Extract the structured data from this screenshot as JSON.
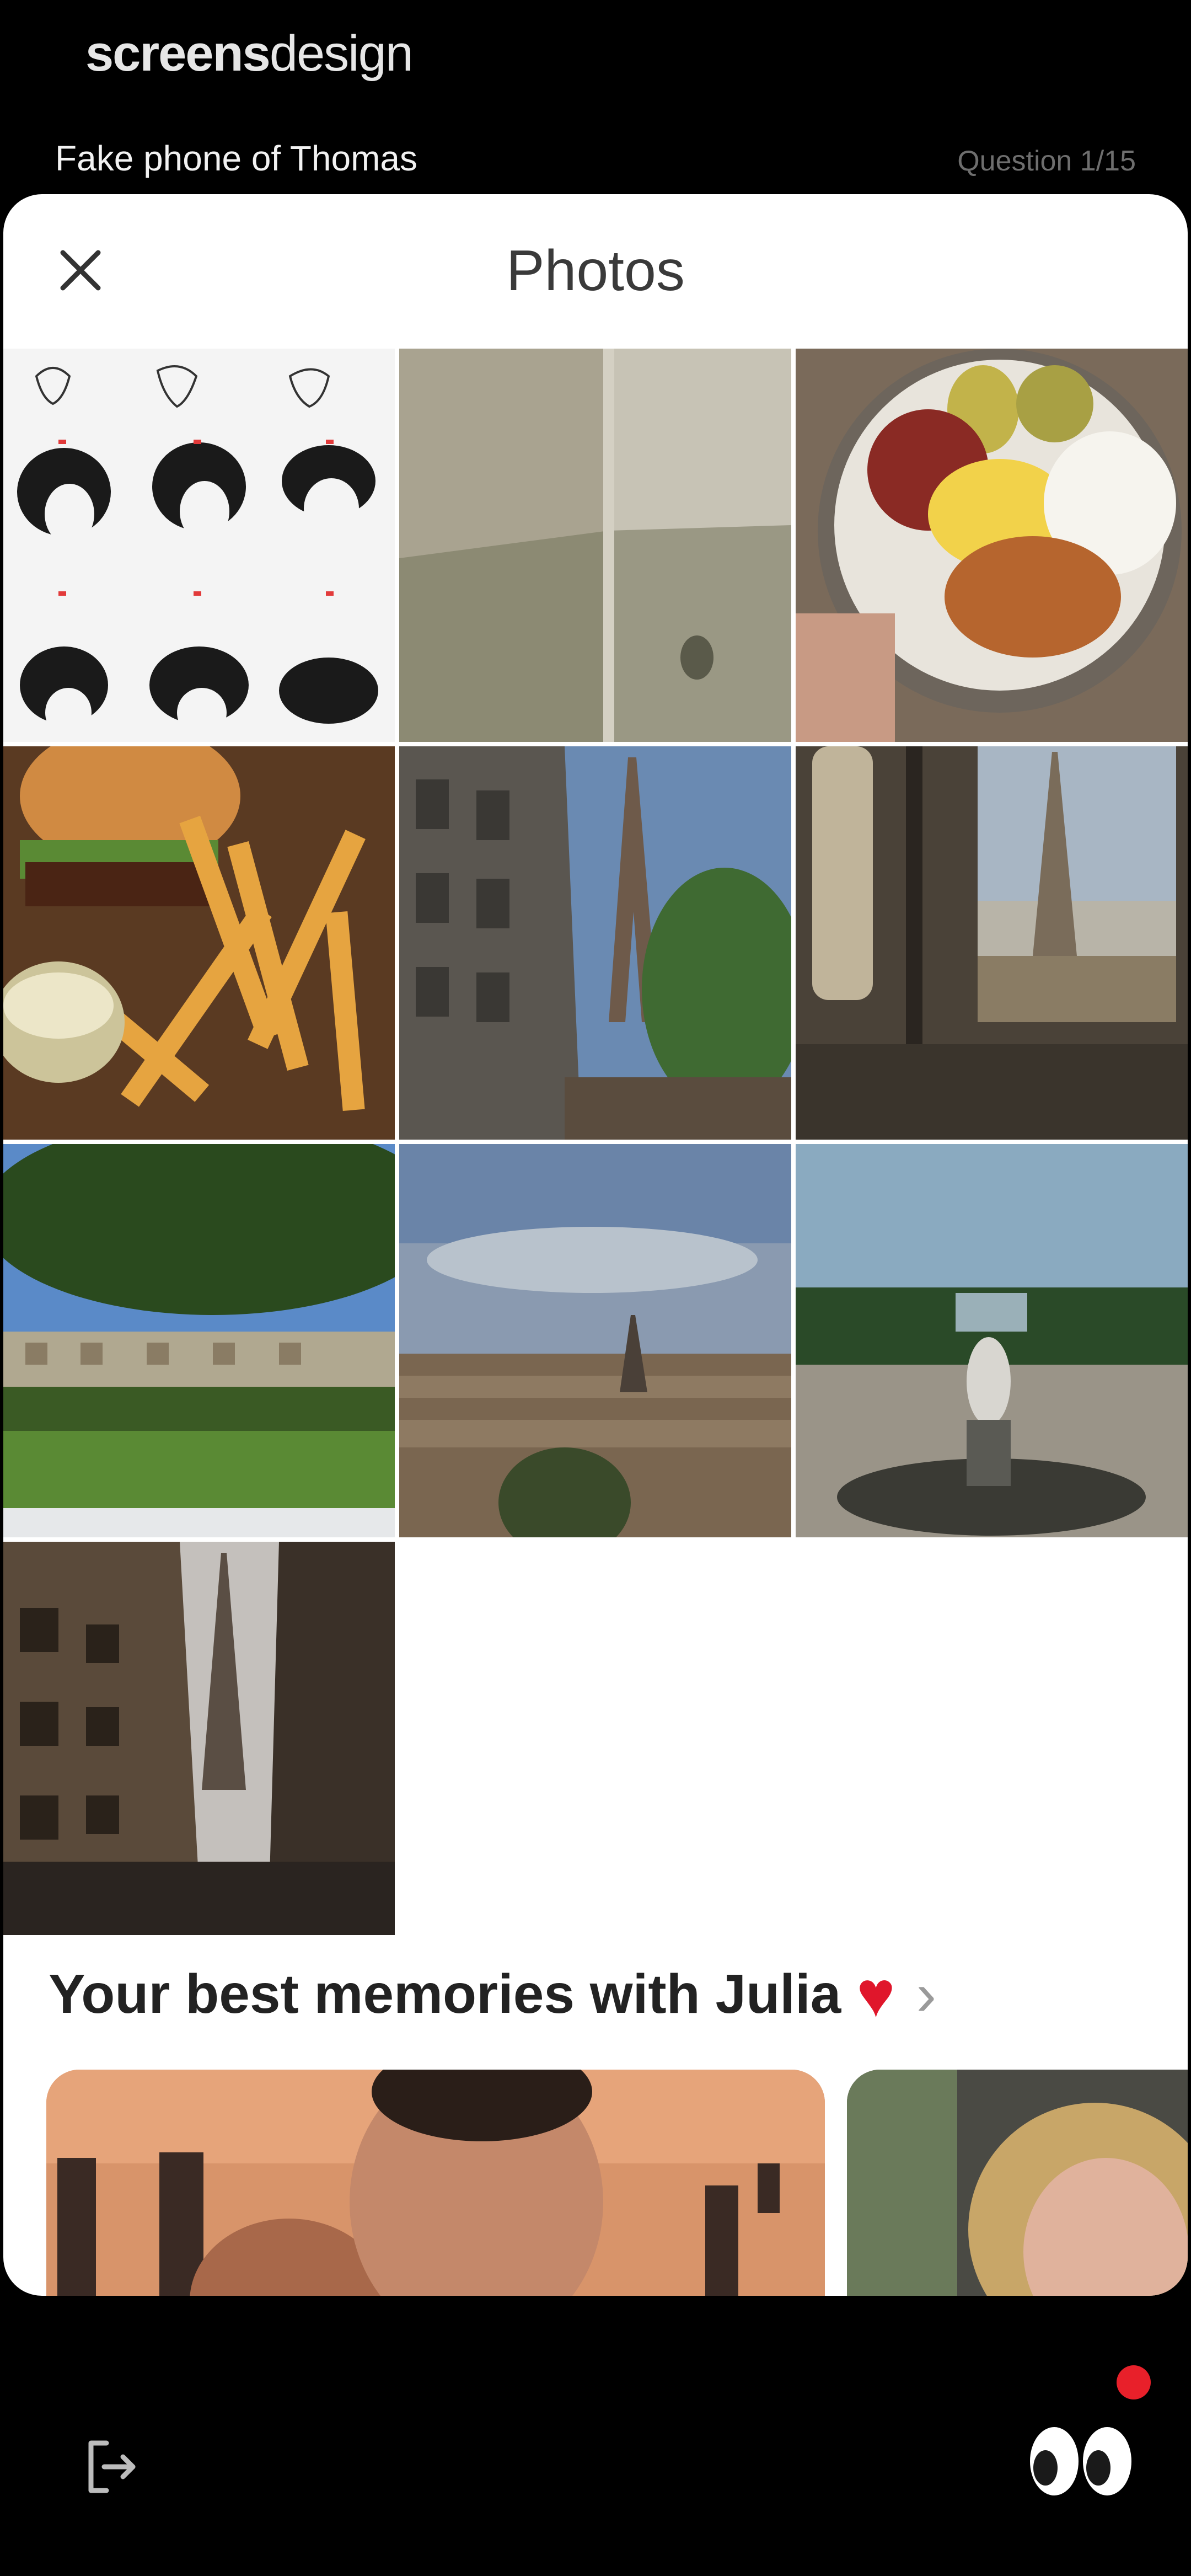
{
  "brand": {
    "bold": "screens",
    "light": "design"
  },
  "device_name": "Fake phone of Thomas",
  "question_counter": "Question 1/15",
  "sheet": {
    "title": "Photos"
  },
  "photos": [
    {
      "name": "photo-hairstyle-chart",
      "subject": "hairstyle reference chart"
    },
    {
      "name": "photo-room-corner",
      "subject": "empty room corner"
    },
    {
      "name": "photo-breakfast-plate",
      "subject": "breakfast plate"
    },
    {
      "name": "photo-burger-fries",
      "subject": "burger and fries"
    },
    {
      "name": "photo-eiffel-street",
      "subject": "Eiffel tower from street"
    },
    {
      "name": "photo-eiffel-train-window",
      "subject": "Eiffel tower through train window"
    },
    {
      "name": "photo-park-square",
      "subject": "park square"
    },
    {
      "name": "photo-paris-skyline",
      "subject": "Paris skyline"
    },
    {
      "name": "photo-versailles-fountain",
      "subject": "garden fountain"
    },
    {
      "name": "photo-eiffel-avenue",
      "subject": "Eiffel tower avenue"
    }
  ],
  "memories": {
    "title": "Your best memories with Julia",
    "heart": "♥",
    "chevron": "›"
  },
  "colors": {
    "background": "#000000",
    "sheet": "#ffffff",
    "heart": "#e0162b",
    "notification": "#e8202a"
  },
  "icons": {
    "close": "close-icon",
    "logout": "logout-icon",
    "eyes": "eyes-icon"
  }
}
